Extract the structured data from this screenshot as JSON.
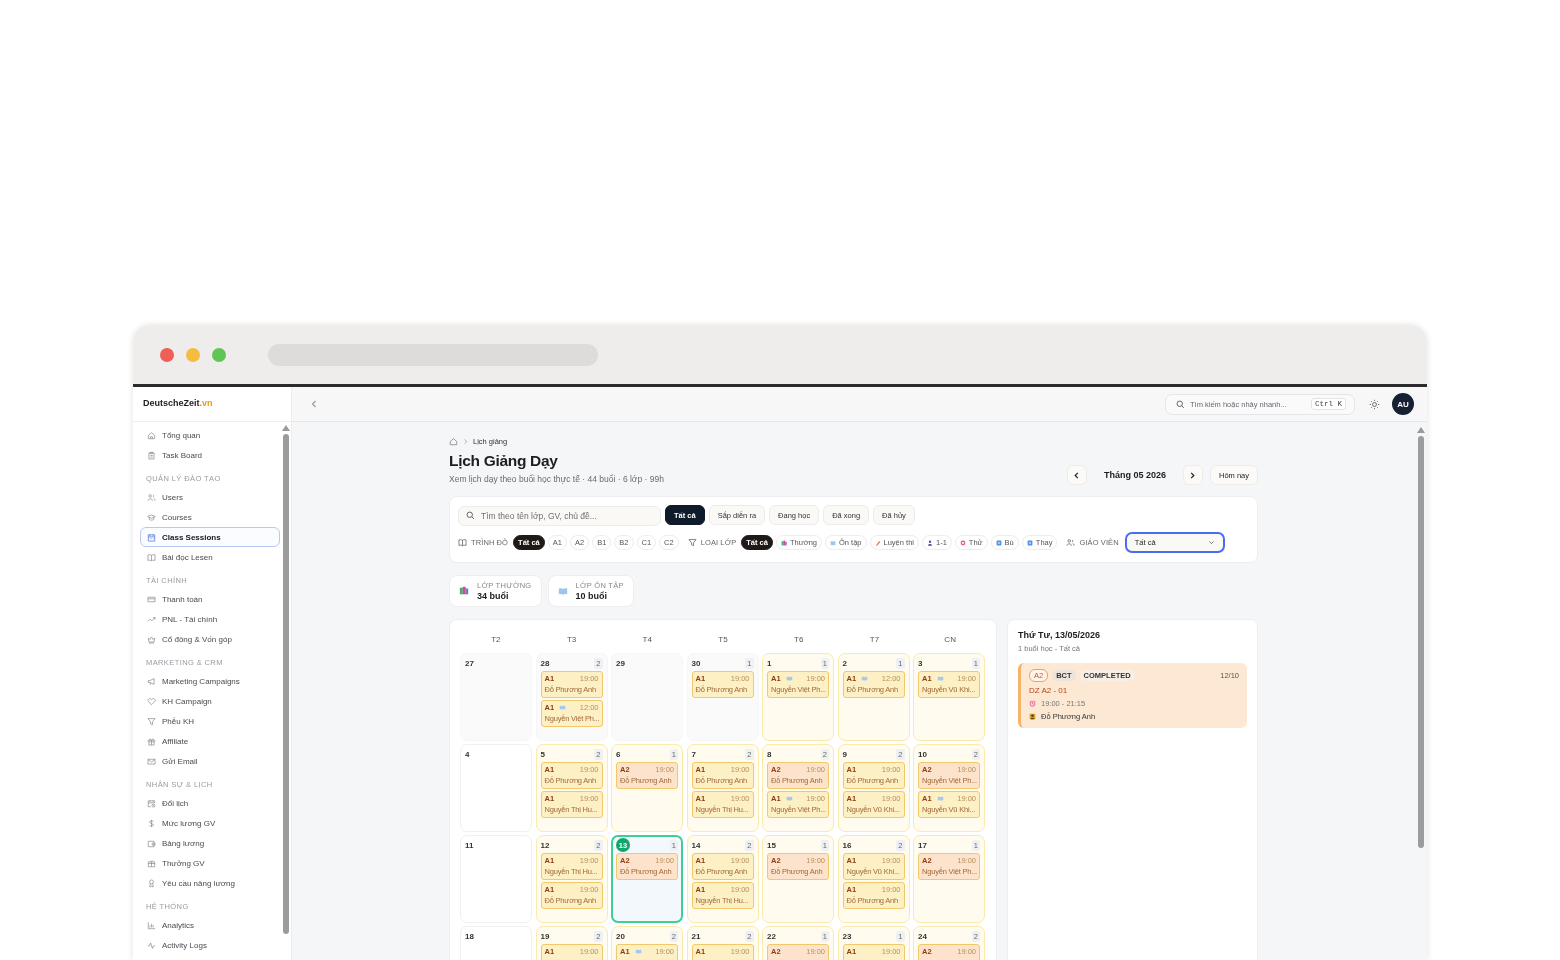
{
  "sidebar": {
    "brand": "DeutscheZeit",
    "brand_suffix": ".vn",
    "sections": [
      {
        "items": [
          {
            "label": "Tổng quan",
            "selected": false
          },
          {
            "label": "Task Board",
            "selected": false
          }
        ]
      },
      {
        "title": "QUẢN LÝ ĐÀO TẠO",
        "items": [
          {
            "label": "Users",
            "selected": false
          },
          {
            "label": "Courses",
            "selected": false
          },
          {
            "label": "Class Sessions",
            "selected": true
          },
          {
            "label": "Bài đọc Lesen",
            "selected": false
          }
        ]
      },
      {
        "title": "TÀI CHÍNH",
        "items": [
          {
            "label": "Thanh toán",
            "selected": false
          },
          {
            "label": "PNL - Tài chính",
            "selected": false
          },
          {
            "label": "Cổ đông & Vốn góp",
            "selected": false
          }
        ]
      },
      {
        "title": "MARKETING & CRM",
        "items": [
          {
            "label": "Marketing Campaigns",
            "selected": false
          },
          {
            "label": "KH Campaign",
            "selected": false
          },
          {
            "label": "Phễu KH",
            "selected": false
          },
          {
            "label": "Affiliate",
            "selected": false
          },
          {
            "label": "Gửi Email",
            "selected": false
          }
        ]
      },
      {
        "title": "NHÂN SỰ & LỊCH",
        "items": [
          {
            "label": "Đổi lịch",
            "selected": false
          },
          {
            "label": "Mức lương GV",
            "selected": false
          },
          {
            "label": "Bảng lương",
            "selected": false
          },
          {
            "label": "Thưởng GV",
            "selected": false
          },
          {
            "label": "Yêu cầu nâng lương",
            "selected": false
          }
        ]
      },
      {
        "title": "HỆ THỐNG",
        "items": [
          {
            "label": "Analytics",
            "selected": false
          },
          {
            "label": "Activity Logs",
            "selected": false
          }
        ]
      }
    ]
  },
  "topbar": {
    "search_placeholder": "Tìm kiếm hoặc nhảy nhanh...",
    "shortcut": "Ctrl K",
    "avatar": "AU"
  },
  "breadcrumb": [
    "Lịch giảng"
  ],
  "page": {
    "title": "Lịch Giảng Dạy",
    "subtitle": "Xem lịch dạy theo buổi học thực tế · 44 buổi · 6 lớp · 99h"
  },
  "month_nav": {
    "label": "Tháng 05 2026",
    "today_button": "Hôm nay"
  },
  "filters": {
    "search": {
      "placeholder": "Tìm theo tên lớp, GV, chủ đề..."
    },
    "statuses": [
      {
        "label": "Tất cả",
        "selected": true
      },
      {
        "label": "Sắp diễn ra",
        "selected": false
      },
      {
        "label": "Đang học",
        "selected": false
      },
      {
        "label": "Đã xong",
        "selected": false
      },
      {
        "label": "Đã hủy",
        "selected": false
      }
    ],
    "level": {
      "label": "TRÌNH ĐỘ",
      "chips": [
        {
          "label": "Tất cả",
          "selected": true
        },
        {
          "label": "A1",
          "selected": false
        },
        {
          "label": "A2",
          "selected": false
        },
        {
          "label": "B1",
          "selected": false
        },
        {
          "label": "B2",
          "selected": false
        },
        {
          "label": "C1",
          "selected": false
        },
        {
          "label": "C2",
          "selected": false
        }
      ]
    },
    "class_type": {
      "label": "LOẠI LỚP",
      "chips": [
        {
          "label": "Tất cả",
          "selected": true
        },
        {
          "label": "Thường",
          "selected": false
        },
        {
          "label": "Ôn tập",
          "selected": false
        },
        {
          "label": "Luyện thi",
          "selected": false
        },
        {
          "label": "1-1",
          "selected": false
        },
        {
          "label": "Thử",
          "selected": false
        },
        {
          "label": "Bù",
          "selected": false
        },
        {
          "label": "Thay",
          "selected": false
        }
      ]
    },
    "teacher": {
      "label": "GIÁO VIÊN",
      "value": "Tất cả"
    }
  },
  "stats": [
    {
      "label": "LỚP THƯỜNG",
      "value": "34 buổi"
    },
    {
      "label": "LỚP ÔN TẬP",
      "value": "10 buổi"
    }
  ],
  "calendar": {
    "weekdays": [
      "T2",
      "T3",
      "T4",
      "T5",
      "T6",
      "T7",
      "CN"
    ],
    "weeks": [
      [
        {
          "day": "27",
          "kind": "other_month",
          "selected": false
        },
        {
          "day": "28",
          "kind": "other_month",
          "selected": false,
          "count": "2",
          "events": [
            {
              "level": "A1",
              "time": "19:00",
              "teacher": "Đỗ Phương Anh",
              "review": false,
              "color": "#fdf0c4"
            },
            {
              "level": "A1",
              "time": "12:00",
              "teacher": "Nguyễn Việt Ph...",
              "review": true,
              "color": "#fdf0c4"
            }
          ]
        },
        {
          "day": "29",
          "kind": "other_month",
          "selected": false
        },
        {
          "day": "30",
          "kind": "other_month",
          "selected": false,
          "count": "1",
          "events": [
            {
              "level": "A1",
              "time": "19:00",
              "teacher": "Đỗ Phương Anh",
              "review": false,
              "color": "#fdf0c4"
            }
          ]
        },
        {
          "day": "1",
          "kind": "current",
          "selected": false,
          "count": "1",
          "events": [
            {
              "level": "A1",
              "time": "19:00",
              "teacher": "Nguyễn Việt Ph...",
              "review": true,
              "color": "#fdf0c4"
            }
          ]
        },
        {
          "day": "2",
          "kind": "current",
          "selected": false,
          "count": "1",
          "events": [
            {
              "level": "A1",
              "time": "12:00",
              "teacher": "Đỗ Phương Anh",
              "review": true,
              "color": "#fdf0c4"
            }
          ]
        },
        {
          "day": "3",
          "kind": "current",
          "selected": false,
          "count": "1",
          "events": [
            {
              "level": "A1",
              "time": "19:00",
              "teacher": "Nguyễn Vũ Khi...",
              "review": true,
              "color": "#fdf0c4"
            }
          ]
        }
      ],
      [
        {
          "day": "4",
          "kind": "current",
          "selected": false
        },
        {
          "day": "5",
          "kind": "current",
          "selected": false,
          "count": "2",
          "events": [
            {
              "level": "A1",
              "time": "19:00",
              "teacher": "Đỗ Phương Anh",
              "review": false,
              "color": "#fdf0c4"
            },
            {
              "level": "A1",
              "time": "19:00",
              "teacher": "Nguyễn Thị Hu...",
              "review": false,
              "color": "#fdf0c4"
            }
          ]
        },
        {
          "day": "6",
          "kind": "current",
          "selected": false,
          "count": "1",
          "events": [
            {
              "level": "A2",
              "time": "19:00",
              "teacher": "Đỗ Phương Anh",
              "review": false,
              "color": "#fde3cc"
            }
          ]
        },
        {
          "day": "7",
          "kind": "current",
          "selected": false,
          "count": "2",
          "events": [
            {
              "level": "A1",
              "time": "19:00",
              "teacher": "Đỗ Phương Anh",
              "review": false,
              "color": "#fdf0c4"
            },
            {
              "level": "A1",
              "time": "19:00",
              "teacher": "Nguyễn Thị Hu...",
              "review": false,
              "color": "#fdf0c4"
            }
          ]
        },
        {
          "day": "8",
          "kind": "current",
          "selected": false,
          "count": "2",
          "events": [
            {
              "level": "A2",
              "time": "19:00",
              "teacher": "Đỗ Phương Anh",
              "review": false,
              "color": "#fde3cc"
            },
            {
              "level": "A1",
              "time": "19:00",
              "teacher": "Nguyễn Việt Ph...",
              "review": true,
              "color": "#fdf0c4"
            }
          ]
        },
        {
          "day": "9",
          "kind": "current",
          "selected": false,
          "count": "2",
          "events": [
            {
              "level": "A1",
              "time": "19:00",
              "teacher": "Đỗ Phương Anh",
              "review": false,
              "color": "#fdf0c4"
            },
            {
              "level": "A1",
              "time": "19:00",
              "teacher": "Nguyễn Vũ Khi...",
              "review": false,
              "color": "#fdf0c4"
            }
          ]
        },
        {
          "day": "10",
          "kind": "current",
          "selected": false,
          "count": "2",
          "events": [
            {
              "level": "A2",
              "time": "19:00",
              "teacher": "Nguyễn Việt Ph...",
              "review": false,
              "color": "#fde3cc"
            },
            {
              "level": "A1",
              "time": "19:00",
              "teacher": "Nguyễn Vũ Khi...",
              "review": true,
              "color": "#fdf0c4"
            }
          ]
        }
      ],
      [
        {
          "day": "11",
          "kind": "current",
          "selected": false
        },
        {
          "day": "12",
          "kind": "current",
          "selected": false,
          "count": "2",
          "events": [
            {
              "level": "A1",
              "time": "19:00",
              "teacher": "Nguyễn Thị Hu...",
              "review": false,
              "color": "#fdf0c4"
            },
            {
              "level": "A1",
              "time": "19:00",
              "teacher": "Đỗ Phương Anh",
              "review": false,
              "color": "#fdf0c4"
            }
          ]
        },
        {
          "day": "13",
          "kind": "current",
          "selected": true,
          "count": "1",
          "events": [
            {
              "level": "A2",
              "time": "19:00",
              "teacher": "Đỗ Phương Anh",
              "review": false,
              "color": "#fde3cc"
            }
          ]
        },
        {
          "day": "14",
          "kind": "current",
          "selected": false,
          "count": "2",
          "events": [
            {
              "level": "A1",
              "time": "19:00",
              "teacher": "Đỗ Phương Anh",
              "review": false,
              "color": "#fdf0c4"
            },
            {
              "level": "A1",
              "time": "19:00",
              "teacher": "Nguyễn Thị Hu...",
              "review": false,
              "color": "#fdf0c4"
            }
          ]
        },
        {
          "day": "15",
          "kind": "current",
          "selected": false,
          "count": "1",
          "events": [
            {
              "level": "A2",
              "time": "19:00",
              "teacher": "Đỗ Phương Anh",
              "review": false,
              "color": "#fde3cc"
            }
          ]
        },
        {
          "day": "16",
          "kind": "current",
          "selected": false,
          "count": "2",
          "events": [
            {
              "level": "A1",
              "time": "19:00",
              "teacher": "Nguyễn Vũ Khi...",
              "review": false,
              "color": "#fdf0c4"
            },
            {
              "level": "A1",
              "time": "19:00",
              "teacher": "Đỗ Phương Anh",
              "review": false,
              "color": "#fdf0c4"
            }
          ]
        },
        {
          "day": "17",
          "kind": "current",
          "selected": false,
          "count": "1",
          "events": [
            {
              "level": "A2",
              "time": "19:00",
              "teacher": "Nguyễn Việt Ph...",
              "review": false,
              "color": "#fde3cc"
            }
          ]
        }
      ],
      [
        {
          "day": "18",
          "kind": "current",
          "selected": false
        },
        {
          "day": "19",
          "kind": "current",
          "selected": false,
          "count": "2",
          "events": [
            {
              "level": "A1",
              "time": "19:00",
              "review": false,
              "color": "#fdf0c4"
            }
          ]
        },
        {
          "day": "20",
          "kind": "current",
          "selected": false,
          "count": "2",
          "events": [
            {
              "level": "A1",
              "time": "19:00",
              "review": true,
              "color": "#fdf0c4"
            }
          ]
        },
        {
          "day": "21",
          "kind": "current",
          "selected": false,
          "count": "2",
          "events": [
            {
              "level": "A1",
              "time": "19:00",
              "review": false,
              "color": "#fdf0c4"
            }
          ]
        },
        {
          "day": "22",
          "kind": "current",
          "selected": false,
          "count": "1",
          "events": [
            {
              "level": "A2",
              "time": "19:00",
              "review": false,
              "color": "#fde3cc"
            }
          ]
        },
        {
          "day": "23",
          "kind": "current",
          "selected": false,
          "count": "1",
          "events": [
            {
              "level": "A1",
              "time": "19:00",
              "review": false,
              "color": "#fdf0c4"
            }
          ]
        },
        {
          "day": "24",
          "kind": "current",
          "selected": false,
          "count": "2",
          "events": [
            {
              "level": "A2",
              "time": "19:00",
              "review": false,
              "color": "#fde3cc"
            }
          ]
        }
      ]
    ]
  },
  "day_panel": {
    "title": "Thứ Tư, 13/05/2026",
    "subtitle": "1 buổi học - Tất cả",
    "sessions": [
      {
        "level": "A2",
        "tags": [
          "BCT",
          "COMPLETED"
        ],
        "count": "12/10",
        "name": "DZ A2 - 01",
        "time": "19:00 - 21:15",
        "teacher": "Đỗ Phương Anh"
      }
    ]
  }
}
